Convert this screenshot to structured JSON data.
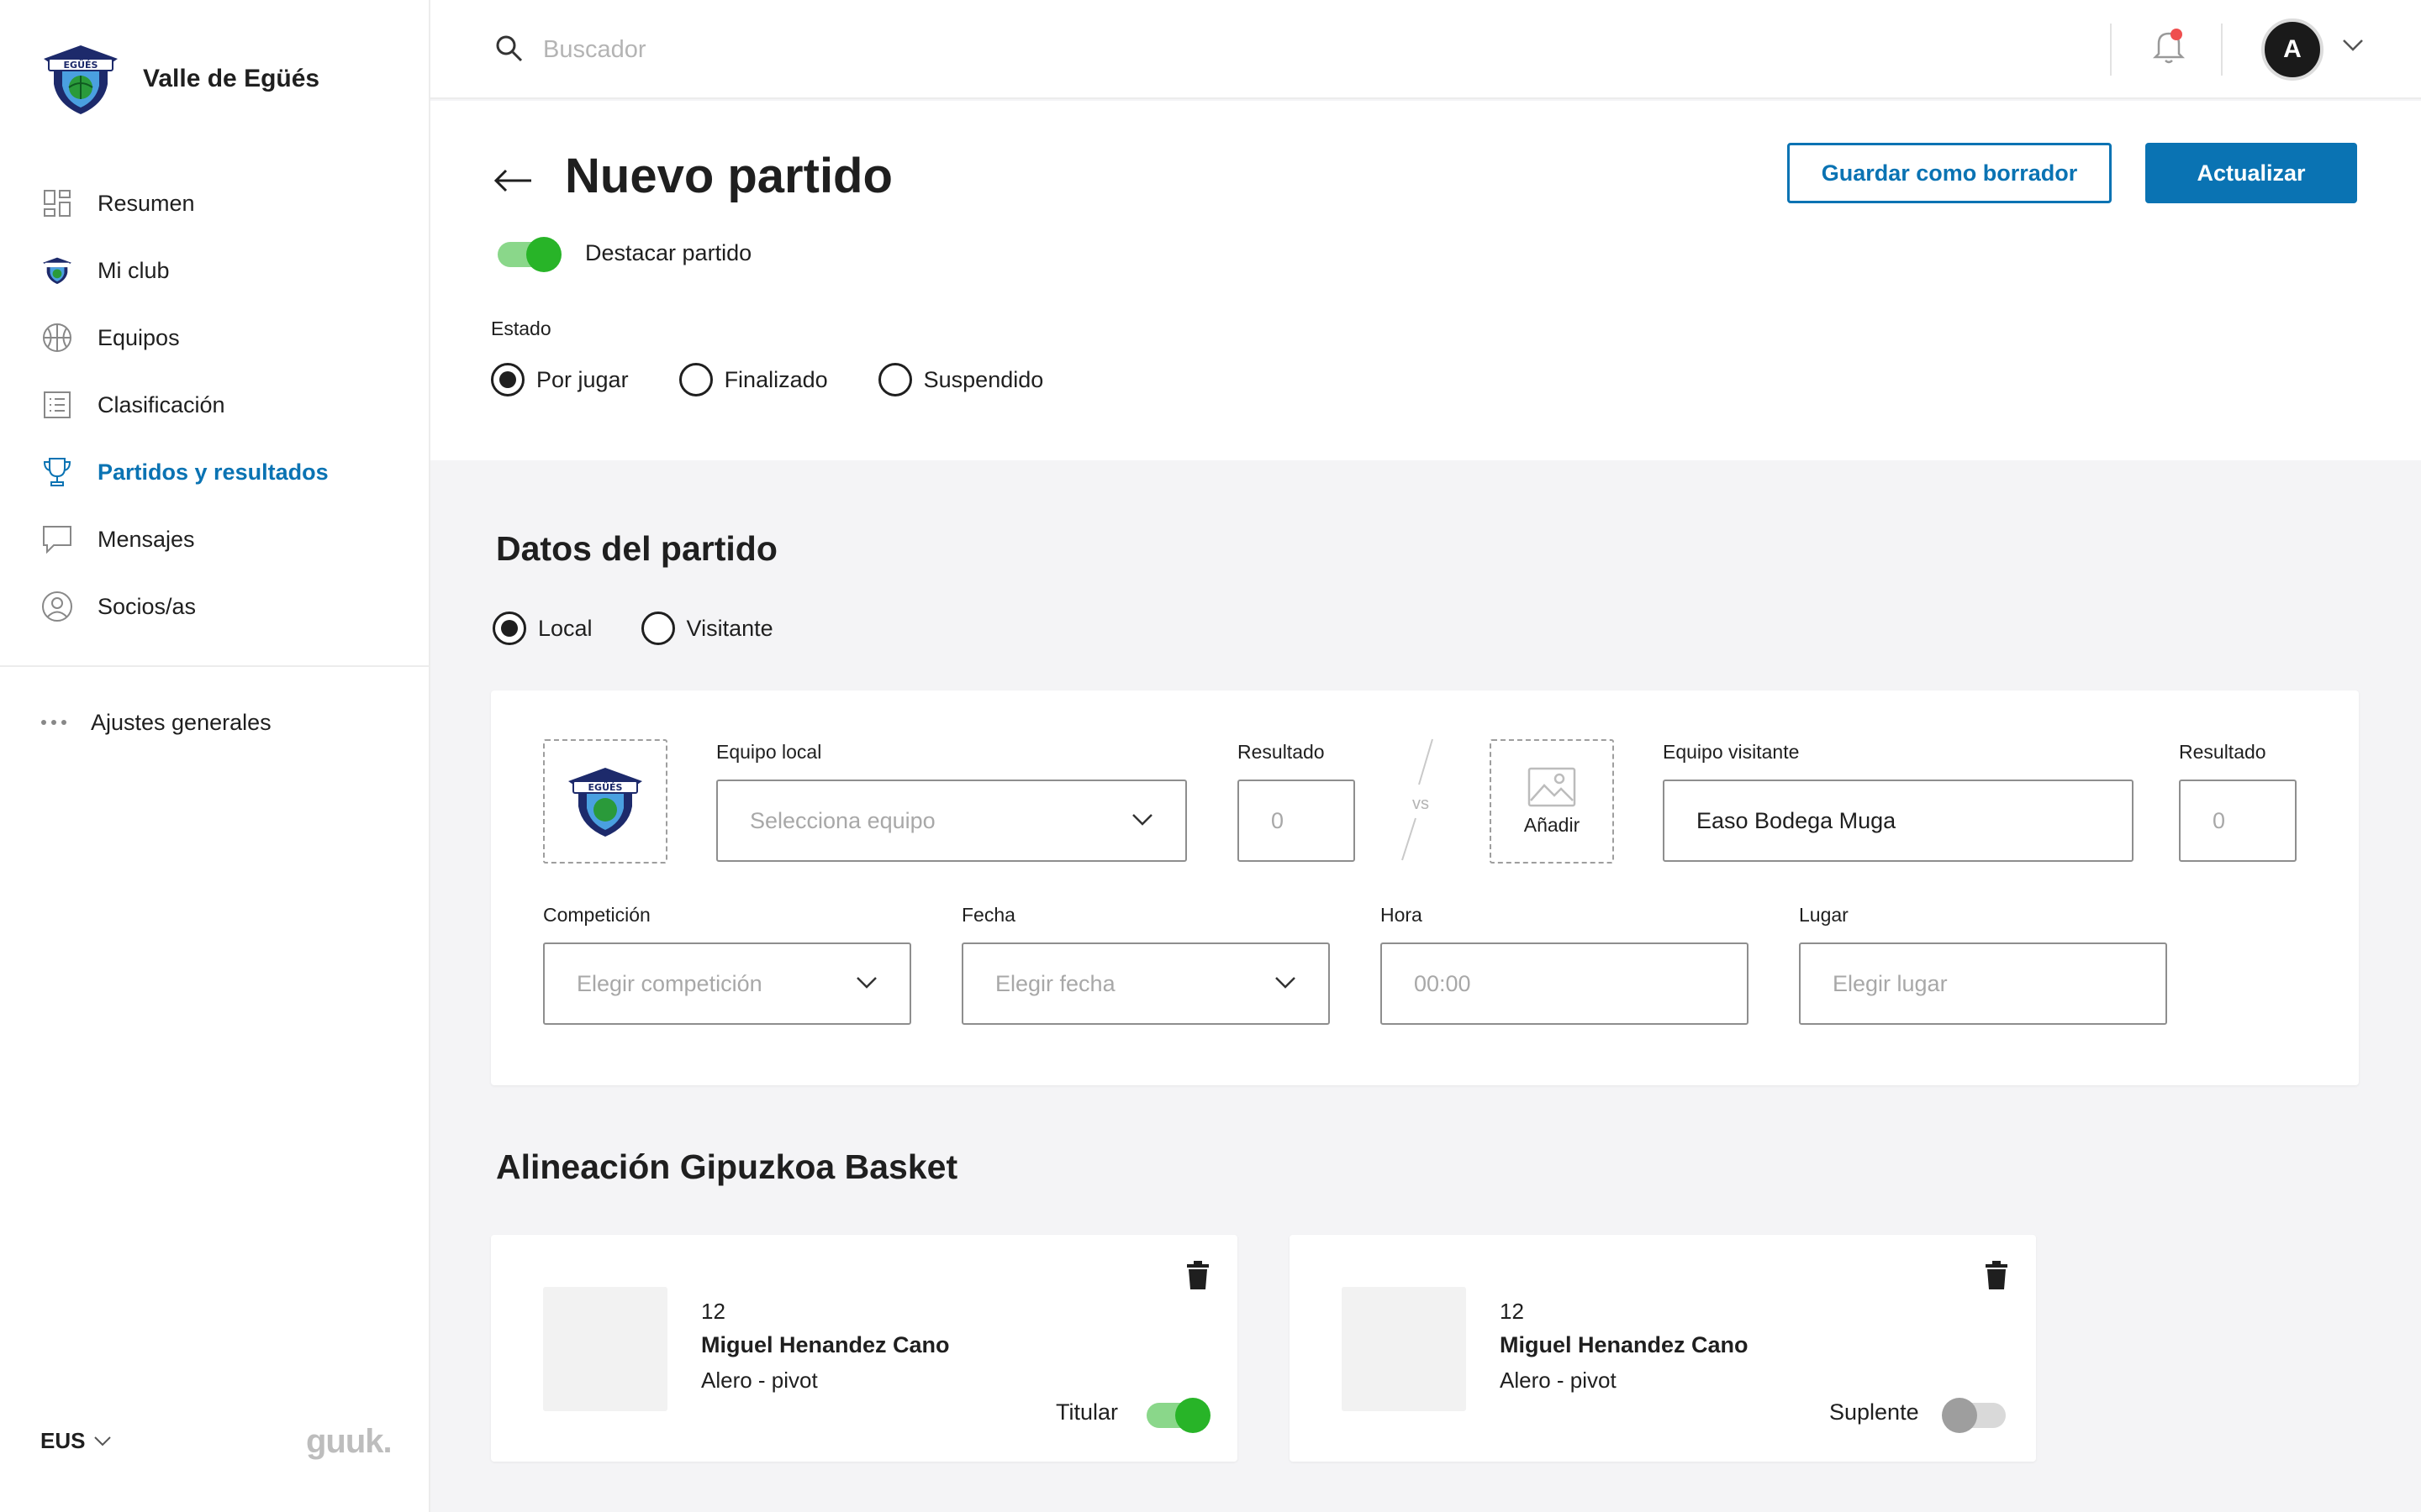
{
  "app": {
    "club_name": "Valle de Egüés"
  },
  "sidebar": {
    "items": [
      {
        "label": "Resumen",
        "icon": "grid-icon"
      },
      {
        "label": "Mi club",
        "icon": "club-logo-icon"
      },
      {
        "label": "Equipos",
        "icon": "basketball-icon"
      },
      {
        "label": "Clasificación",
        "icon": "list-icon"
      },
      {
        "label": "Partidos y resultados",
        "icon": "trophy-icon",
        "active": true
      },
      {
        "label": "Mensajes",
        "icon": "message-icon"
      },
      {
        "label": "Socios/as",
        "icon": "user-icon"
      }
    ],
    "settings_label": "Ajustes generales",
    "language": "EUS",
    "brand_footer": "guuk."
  },
  "topbar": {
    "search_placeholder": "Buscador",
    "avatar_initial": "A"
  },
  "header": {
    "title": "Nuevo partido",
    "save_draft_label": "Guardar como borrador",
    "update_label": "Actualizar",
    "feature_label": "Destacar partido",
    "feature_on": true,
    "estado_label": "Estado",
    "estado_options": [
      "Por jugar",
      "Finalizado",
      "Suspendido"
    ],
    "estado_selected": "Por jugar"
  },
  "match": {
    "section_title": "Datos del partido",
    "location_options": [
      "Local",
      "Visitante"
    ],
    "location_selected": "Local",
    "local_team_label": "Equipo local",
    "local_team_placeholder": "Selecciona equipo",
    "result_label": "Resultado",
    "local_result_placeholder": "0",
    "vs_label": "vs",
    "add_logo_label": "Añadir",
    "away_team_label": "Equipo visitante",
    "away_team_value": "Easo Bodega Muga",
    "away_result_placeholder": "0",
    "competition_label": "Competición",
    "competition_placeholder": "Elegir competición",
    "date_label": "Fecha",
    "date_placeholder": "Elegir fecha",
    "time_label": "Hora",
    "time_placeholder": "00:00",
    "place_label": "Lugar",
    "place_placeholder": "Elegir lugar"
  },
  "lineup": {
    "title": "Alineación Gipuzkoa Basket",
    "players": [
      {
        "number": "12",
        "name": "Miguel Henandez Cano",
        "position": "Alero - pivot",
        "role": "Titular",
        "starter": true
      },
      {
        "number": "12",
        "name": "Miguel Henandez Cano",
        "position": "Alero - pivot",
        "role": "Suplente",
        "starter": false
      }
    ]
  },
  "colors": {
    "accent": "#0a73b3",
    "toggle_on": "#28b428",
    "notification": "#ef4e4e"
  }
}
